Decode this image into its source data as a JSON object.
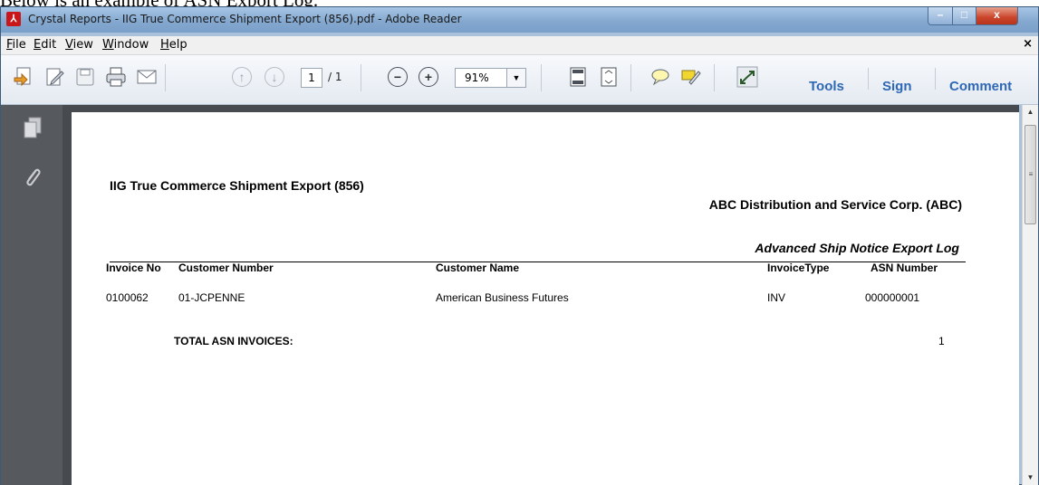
{
  "cropped_caption": "Below is an example of ASN Export Log.",
  "window": {
    "title": "Crystal Reports - IIG True Commerce Shipment Export (856).pdf - Adobe Reader",
    "minimize_glyph": "–",
    "maximize_glyph": "□",
    "close_glyph": "x"
  },
  "menu": {
    "items": [
      "File",
      "Edit",
      "View",
      "Window",
      "Help"
    ],
    "close_doc": "×"
  },
  "toolbar": {
    "page_current": "1",
    "page_total": "/ 1",
    "zoom_value": "91%",
    "zoom_arrow": "▼",
    "tools_label": "Tools",
    "sign_label": "Sign",
    "comment_label": "Comment",
    "icons": [
      "create-pdf-icon",
      "edit-icon",
      "save-icon",
      "print-icon",
      "email-icon",
      "page-up-icon",
      "page-down-icon",
      "zoom-out-icon",
      "zoom-in-icon",
      "fit-page-icon",
      "fit-width-icon",
      "comment-bubble-icon",
      "highlight-icon",
      "expand-icon"
    ]
  },
  "scrollbar": {
    "up_glyph": "▲",
    "down_glyph": "▼",
    "grip": "≡"
  },
  "report": {
    "title": "IIG True Commerce Shipment Export (856)",
    "company": "ABC Distribution and Service Corp. (ABC)",
    "subtitle": "Advanced Ship Notice Export Log",
    "columns": {
      "invoice_no": "Invoice No",
      "customer_number": "Customer Number",
      "customer_name": "Customer Name",
      "invoice_type": "InvoiceType",
      "asn_number": "ASN Number"
    },
    "rows": [
      {
        "invoice_no": "0100062",
        "customer_number": "01-JCPENNE",
        "customer_name": "American Business Futures",
        "invoice_type": "INV",
        "asn_number": "000000001"
      }
    ],
    "total_label": "TOTAL ASN INVOICES:",
    "total_value": "1"
  }
}
